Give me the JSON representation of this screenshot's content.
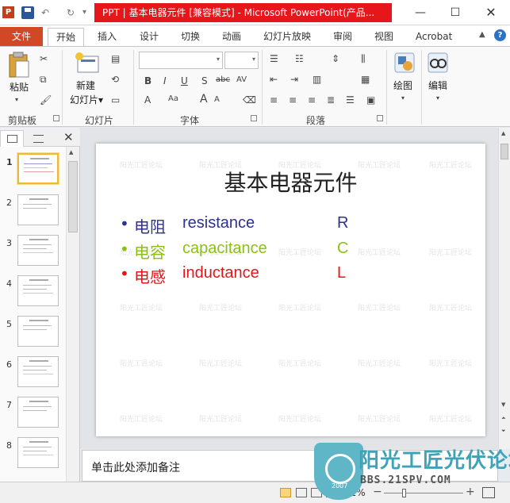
{
  "window": {
    "app_icon": "P",
    "title": "PPT | 基本电器元件 [兼容模式] - Microsoft PowerPoint(产品...",
    "min": "—",
    "max": "☐",
    "close": "✕"
  },
  "qat": {
    "undo": "↶",
    "redo": "↻",
    "more": "▾"
  },
  "tabs": [
    {
      "label": "文件"
    },
    {
      "label": "开始"
    },
    {
      "label": "插入"
    },
    {
      "label": "设计"
    },
    {
      "label": "切换"
    },
    {
      "label": "动画"
    },
    {
      "label": "幻灯片放映"
    },
    {
      "label": "审阅"
    },
    {
      "label": "视图"
    },
    {
      "label": "Acrobat"
    }
  ],
  "tabs_right": {
    "collapse": "▲",
    "help": "?"
  },
  "ribbon": {
    "clipboard": {
      "paste": "粘贴",
      "group": "剪贴板"
    },
    "slides": {
      "new_slide_1": "新建",
      "new_slide_2": "幻灯片▾",
      "group": "幻灯片"
    },
    "font": {
      "group": "字体",
      "bold": "B",
      "italic": "I",
      "underline": "U",
      "shadow": "S",
      "strike": "abc",
      "spacing": "AV",
      "case": "Aa",
      "color": "A",
      "grow": "A",
      "shrink": "A"
    },
    "paragraph": {
      "group": "段落"
    },
    "drawing": {
      "label": "绘图"
    },
    "editing": {
      "label": "编辑"
    }
  },
  "pane": {
    "close": "✕",
    "thumbnails": [
      {
        "num": "1"
      },
      {
        "num": "2"
      },
      {
        "num": "3"
      },
      {
        "num": "4"
      },
      {
        "num": "5"
      },
      {
        "num": "6"
      },
      {
        "num": "7"
      },
      {
        "num": "8"
      }
    ]
  },
  "slide": {
    "title": "基本电器元件",
    "watermark": "阳光工匠论坛",
    "bullets": [
      {
        "dot": "•",
        "zh": "电阻",
        "en": "resistance",
        "sym": "R",
        "color": "#2e3192"
      },
      {
        "dot": "•",
        "zh": "电容",
        "en": "capacitance",
        "sym": "C",
        "color": "#8cc014"
      },
      {
        "dot": "•",
        "zh": "电感",
        "en": "inductance",
        "sym": "L",
        "color": "#e1161b"
      }
    ]
  },
  "notes": {
    "placeholder": "单击此处添加备注"
  },
  "status": {
    "zoom": "51%",
    "zoom_minus": "−",
    "zoom_plus": "+"
  },
  "logo": {
    "title": "阳光工匠光伏论坛",
    "url": "BBS.21SPV.COM",
    "year": "2007"
  }
}
